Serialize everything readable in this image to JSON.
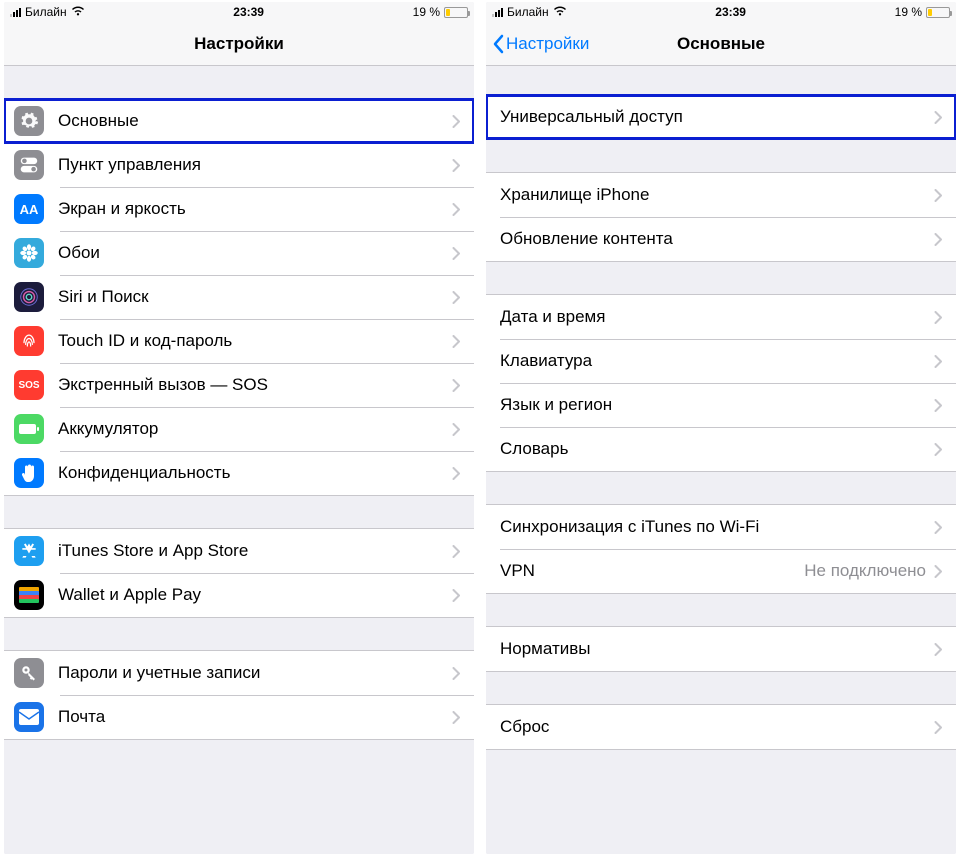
{
  "status": {
    "carrier": "Билайн",
    "time": "23:39",
    "battery_text": "19 %",
    "battery_pct": 19
  },
  "left": {
    "title": "Настройки",
    "groups": [
      [
        {
          "label": "Основные",
          "highlight": true,
          "icon": {
            "bg": "#8e8e93",
            "glyph": "gear"
          }
        },
        {
          "label": "Пункт управления",
          "highlight": false,
          "icon": {
            "bg": "#8e8e93",
            "glyph": "toggles"
          }
        },
        {
          "label": "Экран и яркость",
          "highlight": false,
          "icon": {
            "bg": "#007aff",
            "glyph": "AA"
          }
        },
        {
          "label": "Обои",
          "highlight": false,
          "icon": {
            "bg": "#34aadc",
            "glyph": "flower"
          }
        },
        {
          "label": "Siri и Поиск",
          "highlight": false,
          "icon": {
            "bg": "#1c1c3c",
            "glyph": "siri"
          }
        },
        {
          "label": "Touch ID и код-пароль",
          "highlight": false,
          "icon": {
            "bg": "#ff3b30",
            "glyph": "finger"
          }
        },
        {
          "label": "Экстренный вызов — SOS",
          "highlight": false,
          "icon": {
            "bg": "#ff3b30",
            "glyph": "SOS",
            "text": true
          }
        },
        {
          "label": "Аккумулятор",
          "highlight": false,
          "icon": {
            "bg": "#4cd964",
            "glyph": "batt"
          }
        },
        {
          "label": "Конфиденциальность",
          "highlight": false,
          "icon": {
            "bg": "#007aff",
            "glyph": "hand"
          }
        }
      ],
      [
        {
          "label": "iTunes Store и App Store",
          "highlight": false,
          "icon": {
            "bg": "#1e9ff0",
            "glyph": "appstore"
          }
        },
        {
          "label": "Wallet и Apple Pay",
          "highlight": false,
          "icon": {
            "bg": "#000",
            "glyph": "wallet"
          }
        }
      ],
      [
        {
          "label": "Пароли и учетные записи",
          "highlight": false,
          "icon": {
            "bg": "#8e8e93",
            "glyph": "key"
          }
        },
        {
          "label": "Почта",
          "highlight": false,
          "icon": {
            "bg": "#1a73e8",
            "glyph": "mail"
          }
        }
      ]
    ]
  },
  "right": {
    "title": "Основные",
    "back": "Настройки",
    "groups": [
      [
        {
          "label": "Универсальный доступ",
          "highlight": true
        }
      ],
      [
        {
          "label": "Хранилище iPhone",
          "highlight": false
        },
        {
          "label": "Обновление контента",
          "highlight": false
        }
      ],
      [
        {
          "label": "Дата и время",
          "highlight": false
        },
        {
          "label": "Клавиатура",
          "highlight": false
        },
        {
          "label": "Язык и регион",
          "highlight": false
        },
        {
          "label": "Словарь",
          "highlight": false
        }
      ],
      [
        {
          "label": "Синхронизация с iTunes по Wi-Fi",
          "highlight": false
        },
        {
          "label": "VPN",
          "highlight": false,
          "value": "Не подключено"
        }
      ],
      [
        {
          "label": "Нормативы",
          "highlight": false
        }
      ],
      [
        {
          "label": "Сброс",
          "highlight": false
        }
      ]
    ]
  }
}
